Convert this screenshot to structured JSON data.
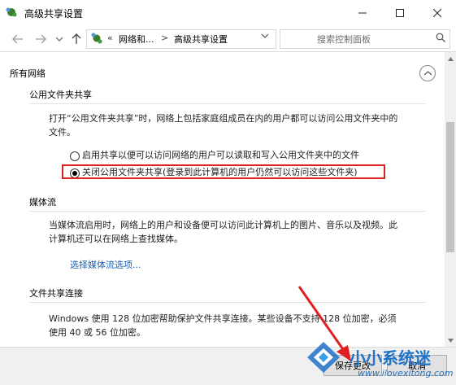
{
  "window": {
    "title": "高级共享设置"
  },
  "address": {
    "chevrons": "«",
    "seg1": "网络和...",
    "sep": ">",
    "seg2": "高级共享设置"
  },
  "search": {
    "placeholder": "搜索控制面板"
  },
  "content": {
    "group_title": "所有网络",
    "public_folder": {
      "title": "公用文件夹共享",
      "desc_line1": "打开“公用文件夹共享”时，网络上包括家庭组成员在内的用户都可以访问公用文件夹中的",
      "desc_line2": "文件。",
      "option_on": "启用共享以便可以访问网络的用户可以读取和写入公用文件夹中的文件",
      "option_off": "关闭公用文件夹共享(登录到此计算机的用户仍然可以访问这些文件夹)",
      "selected": "option_off"
    },
    "media": {
      "title": "媒体流",
      "desc_line1": "当媒体流启用时，网络上的用户和设备便可以访问此计算机上的图片、音乐以及视频。此",
      "desc_line2": "计算机还可以在网络上查找媒体。",
      "link": "选择媒体流选项..."
    },
    "file_sharing": {
      "title": "文件共享连接",
      "desc_line1": "Windows 使用 128 位加密帮助保护文件共享连接。某些设备不支持 128 位加密，必须",
      "desc_line2": "使用 40 或 56 位加密。"
    }
  },
  "buttons": {
    "save": "保存更改",
    "cancel": "取消"
  },
  "watermark": {
    "brand": "小小系统迷",
    "url": "www.ilovexitong.com"
  },
  "colors": {
    "accent": "#1a5fb4",
    "annotation": "#e02020",
    "brand": "#1e72c8"
  }
}
